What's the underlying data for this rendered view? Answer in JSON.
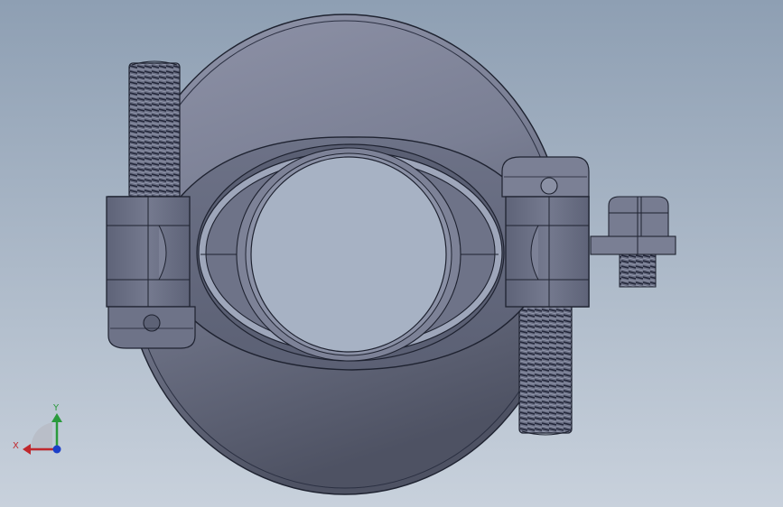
{
  "viewport": {
    "background_top": "#8e9fb3",
    "background_bottom": "#c8d1dc"
  },
  "model": {
    "part_color": "#6a6f84",
    "edge_color": "#1e2230",
    "highlight_color": "#9aa0b4"
  },
  "triad": {
    "x_label": "X",
    "y_label": "Y",
    "x_color": "#c0282d",
    "y_color": "#2a9a3c",
    "z_color": "#1b3fc8"
  }
}
